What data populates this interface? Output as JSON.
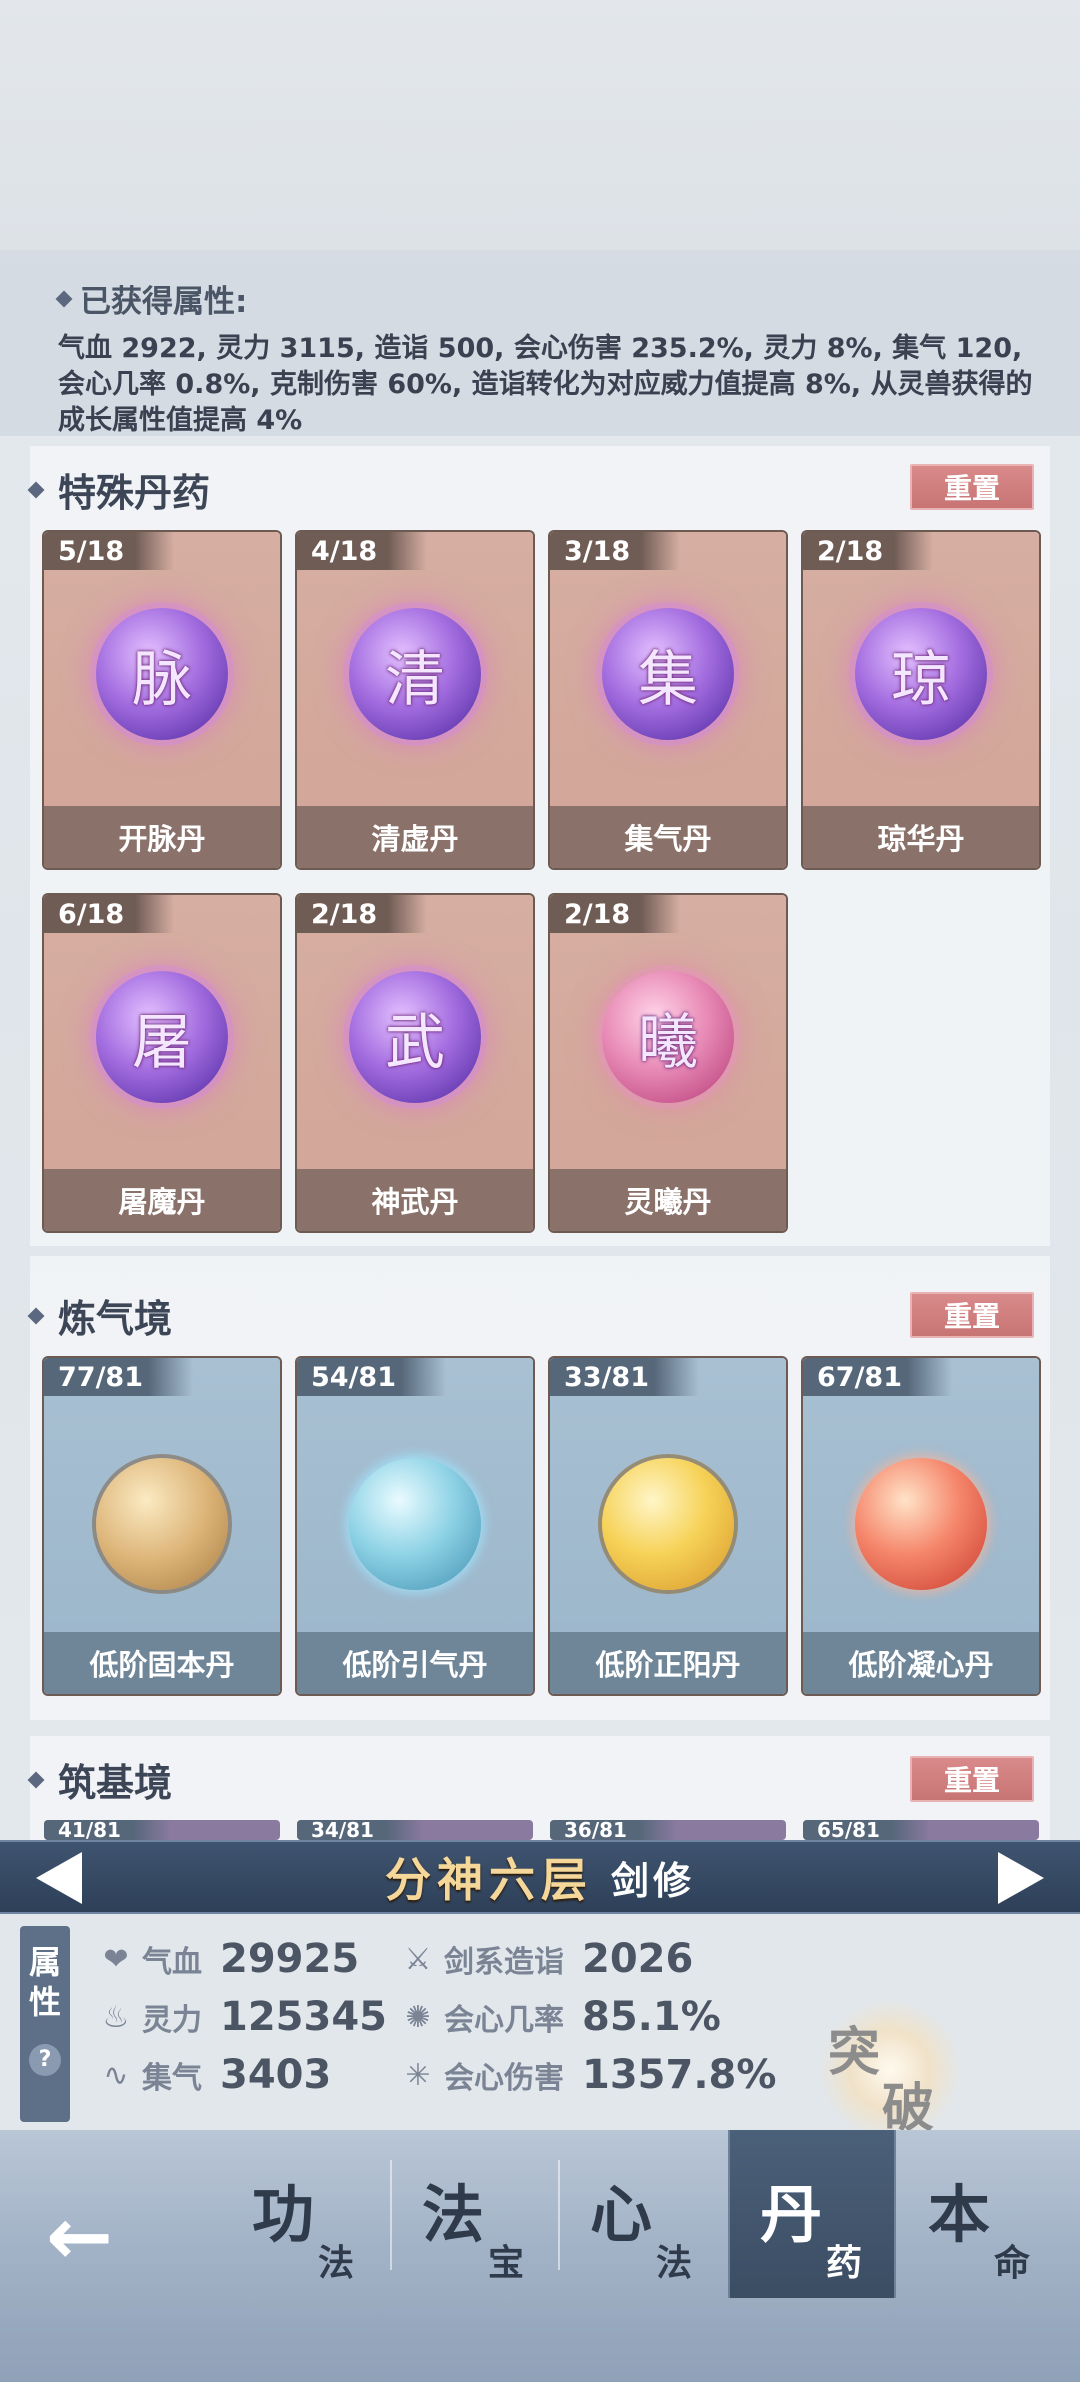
{
  "summary": {
    "title": "已获得属性:",
    "text": "气血 2922, 灵力 3115, 造诣 500, 会心伤害 235.2%, 灵力 8%, 集气 120, 会心几率 0.8%, 克制伤害 60%, 造诣转化为对应威力值提高 8%, 从灵兽获得的成长属性值提高 4%"
  },
  "special": {
    "title": "特殊丹药",
    "reset": "重置",
    "items": [
      {
        "count": "5/18",
        "glyph": "脉",
        "name": "开脉丹"
      },
      {
        "count": "4/18",
        "glyph": "清",
        "name": "清虚丹"
      },
      {
        "count": "3/18",
        "glyph": "集",
        "name": "集气丹"
      },
      {
        "count": "2/18",
        "glyph": "琼",
        "name": "琼华丹"
      },
      {
        "count": "6/18",
        "glyph": "屠",
        "name": "屠魔丹"
      },
      {
        "count": "2/18",
        "glyph": "武",
        "name": "神武丹"
      },
      {
        "count": "2/18",
        "glyph": "曦",
        "name": "灵曦丹"
      }
    ]
  },
  "lianqi": {
    "title": "炼气境",
    "reset": "重置",
    "items": [
      {
        "count": "77/81",
        "name": "低阶固本丹"
      },
      {
        "count": "54/81",
        "name": "低阶引气丹"
      },
      {
        "count": "33/81",
        "name": "低阶正阳丹"
      },
      {
        "count": "67/81",
        "name": "低阶凝心丹"
      }
    ]
  },
  "zhuji": {
    "title": "筑基境",
    "reset": "重置",
    "counts": [
      "41/81",
      "34/81",
      "36/81",
      "65/81"
    ]
  },
  "realm": {
    "name": "分神六层",
    "class": "剑修"
  },
  "attr_tab": {
    "line1": "属",
    "line2": "性",
    "help": "?"
  },
  "stats": {
    "hp_label": "气血",
    "hp": "29925",
    "sp_label": "灵力",
    "sp": "125345",
    "qi_label": "集气",
    "qi": "3403",
    "sword_label": "剑系造诣",
    "sword": "2026",
    "crit_label": "会心几率",
    "crit": "85.1%",
    "critdmg_label": "会心伤害",
    "critdmg": "1357.8%"
  },
  "breakthrough": {
    "a": "突",
    "b": "破"
  },
  "nav": [
    {
      "big": "功",
      "small": "法"
    },
    {
      "big": "法",
      "small": "宝"
    },
    {
      "big": "心",
      "small": "法"
    },
    {
      "big": "丹",
      "small": "药"
    },
    {
      "big": "本",
      "small": "命"
    }
  ]
}
